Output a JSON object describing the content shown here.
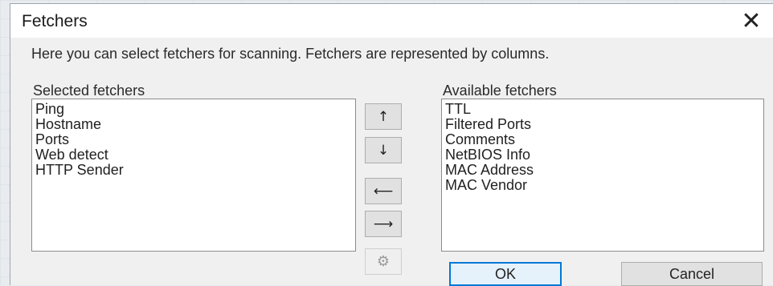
{
  "dialog": {
    "title": "Fetchers",
    "description": "Here you can select fetchers for scanning. Fetchers are represented by columns."
  },
  "selected": {
    "label": "Selected fetchers",
    "items": [
      "Ping",
      "Hostname",
      "Ports",
      "Web detect",
      "HTTP Sender"
    ]
  },
  "available": {
    "label": "Available fetchers",
    "items": [
      "TTL",
      "Filtered Ports",
      "Comments",
      "NetBIOS Info",
      "MAC Address",
      "MAC Vendor"
    ]
  },
  "buttons": {
    "up_glyph": "↑",
    "down_glyph": "↓",
    "left_glyph": "⟵",
    "right_glyph": "⟶",
    "gear_glyph": "⚙",
    "ok_label": "OK",
    "cancel_label": "Cancel",
    "close_glyph": "✕"
  },
  "colors": {
    "default_button_border": "#0078d7"
  }
}
